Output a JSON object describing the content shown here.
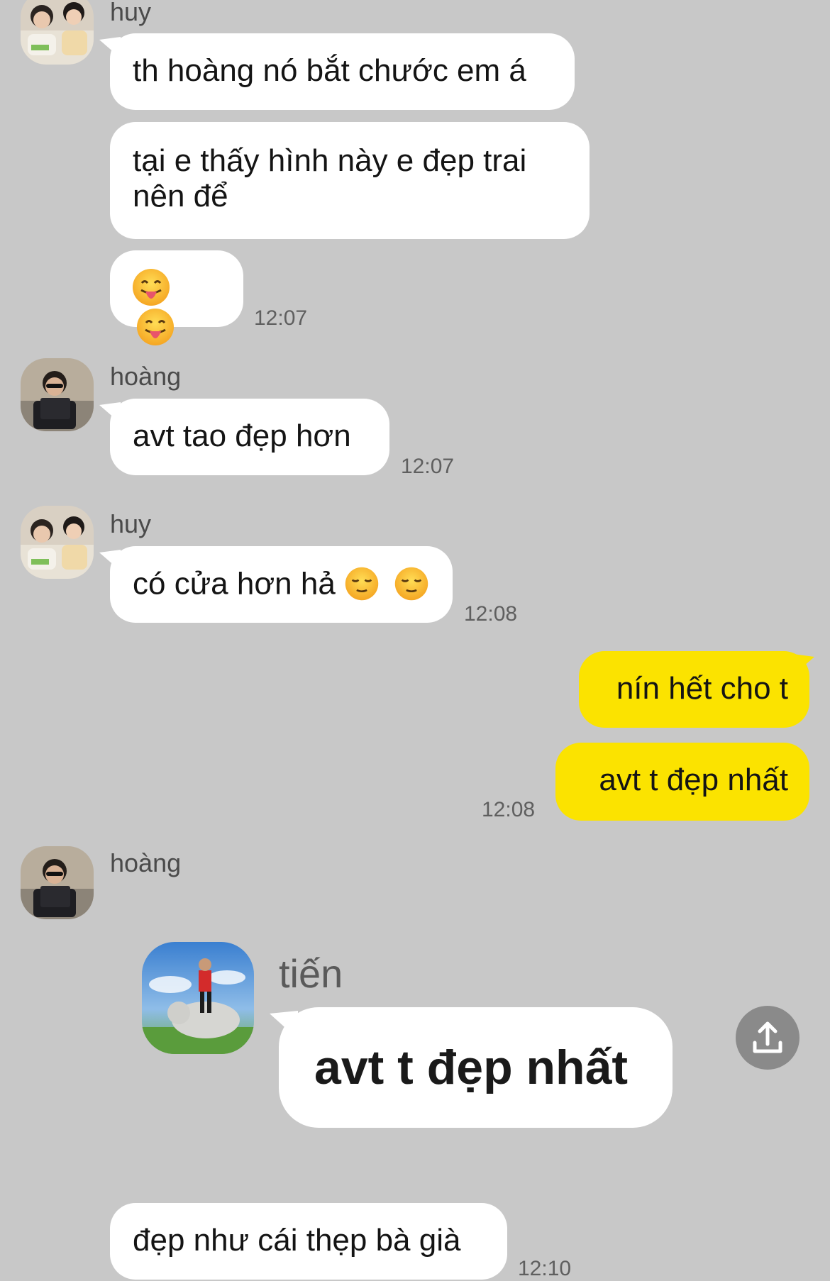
{
  "messages": {
    "m1_sender": "huy",
    "m1_text": "th hoàng nó bắt chước em á",
    "m2_line1": "tại e thấy hình này e đẹp trai",
    "m2_line2": "nên để",
    "m3_time": "12:07",
    "m4_sender": "hoàng",
    "m4_text": "avt tao đẹp hơn",
    "m4_time": "12:07",
    "m5_sender": "huy",
    "m5_text": "có cửa hơn hả",
    "m5_time": "12:08",
    "m6_text": "nín hết cho t",
    "m7_text": "avt t đẹp nhất",
    "m7_time": "12:08",
    "m8_sender": "hoàng",
    "m8_quote_sender": "tiến",
    "m8_quote_text": "avt t đẹp nhất",
    "m9_text": "đẹp như cái thẹp bà già",
    "m9_time": "12:10"
  },
  "colors": {
    "background": "#c8c8c8",
    "incoming_bubble": "#ffffff",
    "outgoing_bubble": "#fbe300",
    "share_button": "#8a8a8a"
  },
  "icons": {
    "emoji_tongue": "face-with-tongue",
    "emoji_pensive": "relieved-face",
    "share": "share-icon"
  }
}
